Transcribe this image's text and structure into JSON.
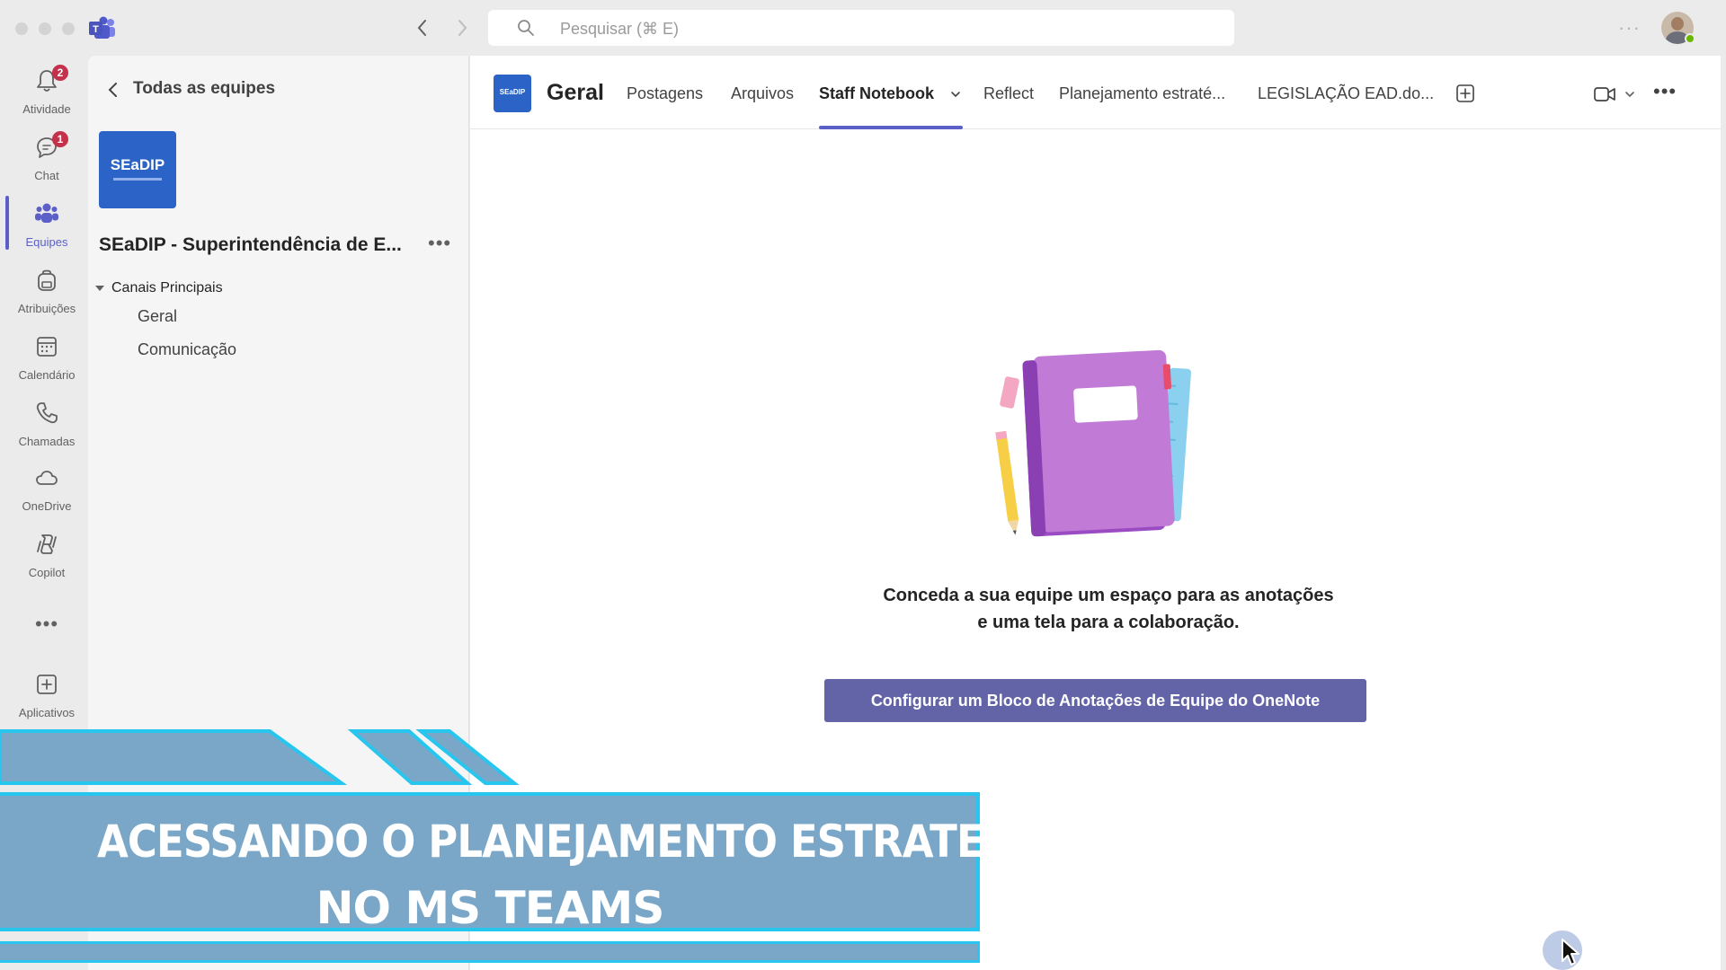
{
  "titlebar": {
    "search_placeholder": "Pesquisar (⌘ E)"
  },
  "rail": {
    "items": [
      {
        "label": "Atividade",
        "badge": "2"
      },
      {
        "label": "Chat",
        "badge": "1"
      },
      {
        "label": "Equipes"
      },
      {
        "label": "Atribuições"
      },
      {
        "label": "Calendário"
      },
      {
        "label": "Chamadas"
      },
      {
        "label": "OneDrive"
      },
      {
        "label": "Copilot"
      },
      {
        "label": "Aplicativos"
      }
    ],
    "more": "•••"
  },
  "team_panel": {
    "back_label": "Todas as equipes",
    "team_logo_text": "SEaDIP",
    "team_name": "SEaDIP - Superintendência de E...",
    "more": "•••",
    "section_label": "Canais Principais",
    "channels": [
      "Geral",
      "Comunicação"
    ]
  },
  "channel_header": {
    "logo_text": "SEaDIP",
    "title": "Geral",
    "tabs": [
      "Postagens",
      "Arquivos",
      "Staff Notebook",
      "Reflect",
      "Planejamento estraté...",
      "LEGISLAÇÃO EAD.do..."
    ],
    "active_tab": "Staff Notebook",
    "more": "•••"
  },
  "empty_state": {
    "line1": "Conceda a sua equipe um espaço para as anotações",
    "line2": "e uma tela para a colaboração.",
    "button_label": "Configurar um Bloco de Anotações de Equipe do OneNote"
  },
  "caption": {
    "line1": "ACESSANDO O PLANEJAMENTO ESTRATEGICO",
    "line2": "NO MS TEAMS"
  },
  "colors": {
    "accent": "#5b5fc7",
    "button": "#6264a7",
    "team_logo": "#2b63c6",
    "caption_fill": "#7aa7c7",
    "caption_border": "#26c6ef"
  }
}
